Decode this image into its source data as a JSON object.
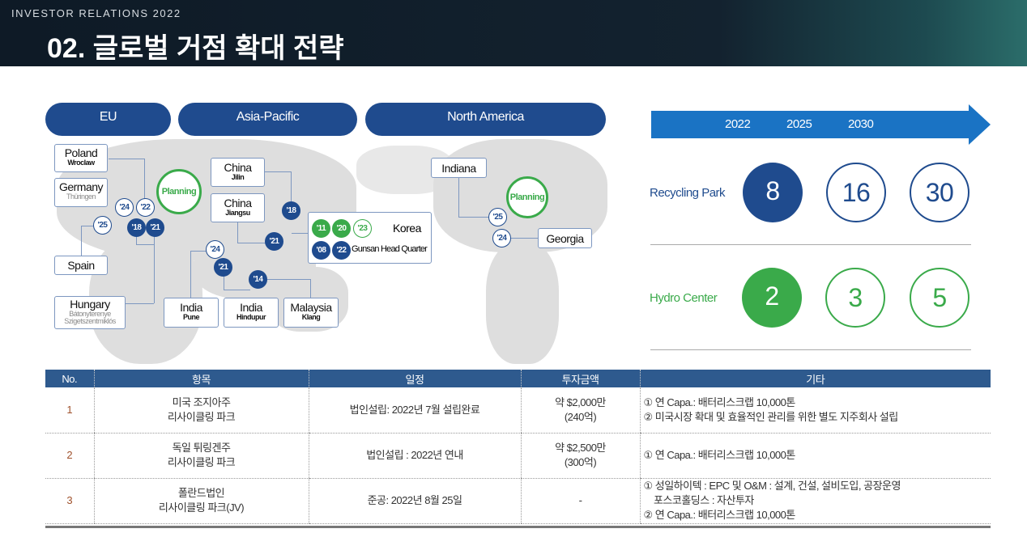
{
  "header": {
    "subtitle": "INVESTOR RELATIONS 2022",
    "title": "02. 글로벌 거점 확대 전략"
  },
  "regions": [
    "EU",
    "Asia-Pacific",
    "North America"
  ],
  "map": {
    "planning": "Planning",
    "poland": {
      "name": "Poland",
      "city": "Wroclaw"
    },
    "germany": {
      "name": "Germany",
      "city": "Thüringen"
    },
    "spain": {
      "name": "Spain"
    },
    "hungary": {
      "name": "Hungary",
      "city1": "Bátonyterenye",
      "city2": "Szigetszentmiklós"
    },
    "china_jilin": {
      "name": "China",
      "city": "Jilin"
    },
    "china_jiangsu": {
      "name": "China",
      "city": "Jiangsu"
    },
    "india_pune": {
      "name": "India",
      "city": "Pune"
    },
    "india_hindupur": {
      "name": "India",
      "city": "Hindupur"
    },
    "malaysia": {
      "name": "Malaysia",
      "city": "Klang"
    },
    "korea": {
      "name": "Korea",
      "hq": "Gunsan Head Quarter"
    },
    "indiana": {
      "name": "Indiana"
    },
    "georgia": {
      "name": "Georgia"
    },
    "markers": {
      "m24": "'24",
      "m22": "'22",
      "m25": "'25",
      "m18": "'18",
      "m21": "'21",
      "jilin18": "'18",
      "jiangsu21": "'21",
      "pune24": "'24",
      "hindupur21": "'21",
      "klang14": "'14",
      "k11": "'11",
      "k20": "'20",
      "k23": "'23",
      "k08": "'08",
      "k22": "'22",
      "in25": "'25",
      "ga24": "'24"
    }
  },
  "timeline": {
    "years": [
      "2022",
      "2025",
      "2030"
    ],
    "recycling": {
      "label": "Recycling Park",
      "values": [
        "8",
        "16",
        "30"
      ]
    },
    "hydro": {
      "label": "Hydro Center",
      "values": [
        "2",
        "3",
        "5"
      ]
    }
  },
  "colors": {
    "navy": "#1f4b8e",
    "green": "#3aaa4a",
    "arrow": "#1a73c4"
  },
  "table": {
    "headers": [
      "No.",
      "항목",
      "일정",
      "투자금액",
      "기타"
    ],
    "rows": [
      {
        "no": "1",
        "item": [
          "미국 조지아주",
          "리사이클링 파크"
        ],
        "schedule": "법인설립: 2022년 7월 설립완료",
        "amount": [
          "약 $2,000만",
          "(240억)"
        ],
        "notes": [
          "① 연 Capa.: 배터리스크랩 10,000톤",
          "② 미국시장 확대 및 효율적인 관리를 위한 별도 지주회사 설립"
        ]
      },
      {
        "no": "2",
        "item": [
          "독일 튀링겐주",
          "리사이클링 파크"
        ],
        "schedule": "법인설립 : 2022년 연내",
        "amount": [
          "약 $2,500만",
          "(300억)"
        ],
        "notes": [
          "① 연 Capa.: 배터리스크랩 10,000톤"
        ]
      },
      {
        "no": "3",
        "item": [
          "폴란드법인",
          "리사이클링 파크(JV)"
        ],
        "schedule": "준공: 2022년 8월 25일",
        "amount": [
          "-"
        ],
        "notes": [
          "① 성일하이텍 : EPC 및 O&M : 설계, 건설, 설비도입, 공장운영",
          "    포스코홀딩스 : 자산투자",
          "② 연 Capa.: 배터리스크랩 10,000톤"
        ]
      }
    ]
  }
}
